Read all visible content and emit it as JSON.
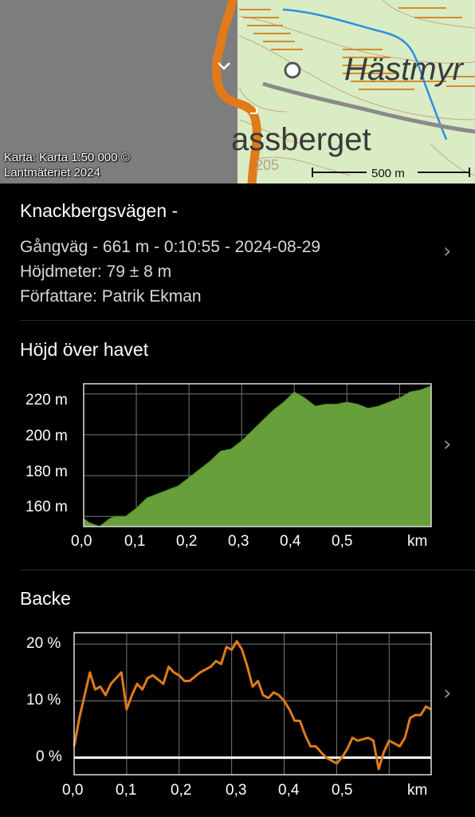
{
  "map": {
    "place_labels": [
      "Hästmyr",
      "assberget"
    ],
    "contour_label": "205",
    "attribution": [
      "Karta: Karta 1:50 000 ©",
      "Lantmäteriet 2024"
    ],
    "scale_label": "500 m",
    "colors": {
      "route": "#e07a1a",
      "land": "#d9ecc4",
      "water": "#2f8fe0",
      "road": "#8a8a8a",
      "unmapped": "#7d7d7d"
    }
  },
  "route": {
    "title": "Knackbergsvägen -",
    "summary": "Gångväg - 661 m - 0:10:55 - 2024-08-29",
    "elevation_gain": "Höjdmeter: 79 ± 8 m",
    "author": "Författare: Patrik Ekman"
  },
  "elevation": {
    "title": "Höjd över havet",
    "y_tick_labels": [
      "220 m",
      "200 m",
      "180 m",
      "160 m"
    ],
    "x_tick_labels": [
      "0,0",
      "0,1",
      "0,2",
      "0,3",
      "0,4",
      "0,5"
    ],
    "x_unit": "km"
  },
  "slope": {
    "title": "Backe",
    "y_tick_labels": [
      "20 %",
      "10 %",
      "0 %"
    ],
    "x_tick_labels": [
      "0,0",
      "0,1",
      "0,2",
      "0,3",
      "0,4",
      "0,5"
    ],
    "x_unit": "km"
  },
  "chart_data": [
    {
      "type": "area",
      "title": "Höjd över havet",
      "xlabel": "km",
      "ylabel": "",
      "xlim": [
        0,
        0.66
      ],
      "ylim": [
        155,
        225
      ],
      "grid": true,
      "color": "#67a03a",
      "x": [
        0.0,
        0.01,
        0.03,
        0.05,
        0.06,
        0.08,
        0.1,
        0.12,
        0.14,
        0.16,
        0.18,
        0.2,
        0.22,
        0.24,
        0.26,
        0.28,
        0.3,
        0.32,
        0.34,
        0.36,
        0.38,
        0.4,
        0.42,
        0.44,
        0.46,
        0.48,
        0.5,
        0.52,
        0.54,
        0.56,
        0.58,
        0.6,
        0.62,
        0.64,
        0.66
      ],
      "y": [
        159,
        157,
        155,
        159,
        160,
        160,
        164,
        169,
        171,
        173,
        175,
        179,
        183,
        187,
        192,
        193,
        197,
        202,
        207,
        212,
        216,
        221,
        218,
        214,
        215,
        215,
        216,
        215,
        213,
        214,
        216,
        218,
        221,
        222,
        224
      ]
    },
    {
      "type": "line",
      "title": "Backe",
      "xlabel": "km",
      "ylabel": "",
      "xlim": [
        0,
        0.68
      ],
      "ylim": [
        -3,
        22
      ],
      "grid": true,
      "color": "#e07a1a",
      "x": [
        0.0,
        0.01,
        0.02,
        0.03,
        0.04,
        0.05,
        0.06,
        0.07,
        0.09,
        0.1,
        0.11,
        0.12,
        0.13,
        0.14,
        0.15,
        0.17,
        0.18,
        0.19,
        0.2,
        0.21,
        0.22,
        0.24,
        0.26,
        0.27,
        0.28,
        0.29,
        0.3,
        0.31,
        0.32,
        0.33,
        0.34,
        0.35,
        0.36,
        0.37,
        0.38,
        0.39,
        0.4,
        0.41,
        0.42,
        0.43,
        0.44,
        0.45,
        0.46,
        0.47,
        0.48,
        0.49,
        0.5,
        0.51,
        0.52,
        0.53,
        0.54,
        0.56,
        0.57,
        0.58,
        0.59,
        0.6,
        0.61,
        0.62,
        0.63,
        0.64,
        0.65,
        0.66,
        0.67,
        0.68
      ],
      "y": [
        2,
        7,
        11,
        15,
        12,
        12.5,
        11,
        13,
        15,
        8.5,
        11,
        13,
        12,
        14,
        14.5,
        13,
        16,
        15,
        14.5,
        13.5,
        13.5,
        15,
        16,
        17,
        16.5,
        19.5,
        19,
        20.5,
        19,
        16,
        12.5,
        13.5,
        11,
        10.5,
        11.5,
        11,
        10,
        8.5,
        6.5,
        6.5,
        4,
        2,
        2,
        1,
        0,
        -0.5,
        -1,
        0,
        1.5,
        3.5,
        3,
        3.5,
        3,
        -2,
        1,
        3,
        2.5,
        2,
        3.5,
        7,
        7.5,
        7.5,
        9,
        8.5
      ]
    }
  ]
}
